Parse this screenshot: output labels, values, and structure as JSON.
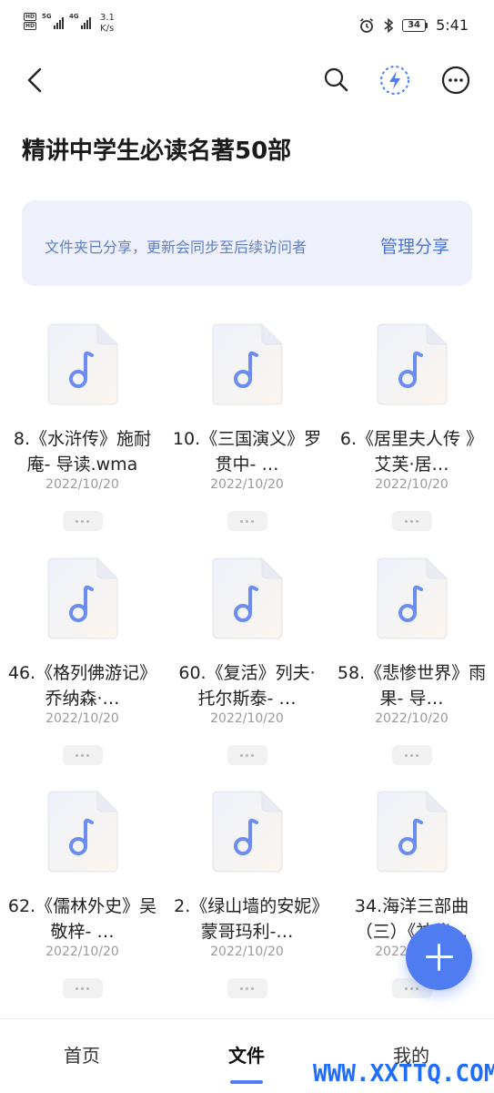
{
  "status_bar": {
    "sim1": "HD",
    "sim2": "HD",
    "signal1_label": "5G",
    "signal2_label": "4G",
    "speed_value": "3.1",
    "speed_unit": "K/s",
    "battery": "34",
    "time": "5:41"
  },
  "header": {
    "title": "精讲中学生必读名著50部"
  },
  "banner": {
    "note": "文件夹已分享，更新会同步至后续访问者",
    "manage_label": "管理分享"
  },
  "files": [
    {
      "name": "8.《水浒传》施耐庵- 导读.wma",
      "date": "2022/10/20"
    },
    {
      "name": "10.《三国演义》罗贯中- …",
      "date": "2022/10/20"
    },
    {
      "name": "6.《居里夫人传 》艾芙·居…",
      "date": "2022/10/20"
    },
    {
      "name": "46.《格列佛游记》乔纳森·…",
      "date": "2022/10/20"
    },
    {
      "name": "60.《复活》列夫·托尔斯泰- …",
      "date": "2022/10/20"
    },
    {
      "name": "58.《悲惨世界》雨果- 导…",
      "date": "2022/10/20"
    },
    {
      "name": "62.《儒林外史》吴敬梓- …",
      "date": "2022/10/20"
    },
    {
      "name": "2.《绿山墙的安妮》蒙哥玛利-…",
      "date": "2022/10/20"
    },
    {
      "name": "34.海洋三部曲（三）《神秘…",
      "date": "2022/10/20"
    }
  ],
  "bottom_nav": {
    "home": "首页",
    "files": "文件",
    "mine": "我的"
  },
  "watermark": "WWW.XXTTQ.COM",
  "icons": {
    "back": "chevron-left-icon",
    "search": "search-icon",
    "flash": "lightning-icon",
    "more": "more-horizontal-icon",
    "file": "music-file-icon",
    "fab": "plus-icon"
  },
  "colors": {
    "accent": "#4f7cf0",
    "banner_bg": "#eef1fc",
    "banner_text": "#5f7ec7"
  }
}
